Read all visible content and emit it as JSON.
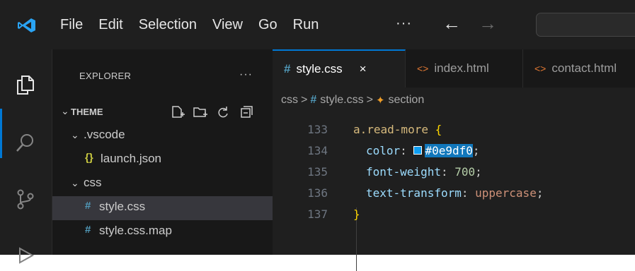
{
  "menu": {
    "items": [
      "File",
      "Edit",
      "Selection",
      "View",
      "Go",
      "Run"
    ],
    "more": "···",
    "back": "←",
    "forward": "→"
  },
  "sidebar": {
    "header": "EXPLORER",
    "more": "···",
    "root_folder": "THEME",
    "tree": [
      {
        "label": ".vscode",
        "type": "folder",
        "expanded": true
      },
      {
        "label": "launch.json",
        "type": "json",
        "icon": "{}"
      },
      {
        "label": "css",
        "type": "folder",
        "expanded": true
      },
      {
        "label": "style.css",
        "type": "css",
        "icon": "#",
        "selected": true
      },
      {
        "label": "style.css.map",
        "type": "css",
        "icon": "#"
      }
    ]
  },
  "tabs": [
    {
      "label": "style.css",
      "icon": "#",
      "active": true,
      "close": "×"
    },
    {
      "label": "index.html",
      "icon": "<>",
      "active": false
    },
    {
      "label": "contact.html",
      "icon": "<>",
      "active": false
    }
  ],
  "breadcrumb": {
    "folder": "css",
    "file": "style.css",
    "symbol": "section",
    "separator": ">"
  },
  "code": {
    "lines": [
      {
        "number": "133",
        "selector": "a.read-more",
        "brace_open": "{"
      },
      {
        "number": "134",
        "property": "color",
        "value": "#0e9df0",
        "swatch_color": "#0e9df0"
      },
      {
        "number": "135",
        "property": "font-weight",
        "value": "700"
      },
      {
        "number": "136",
        "property": "text-transform",
        "value": "uppercase"
      },
      {
        "number": "137",
        "brace_close": "}"
      }
    ]
  },
  "colors": {
    "accent": "#0078d4",
    "css_icon": "#519aba",
    "html_icon": "#e37933",
    "json_icon": "#cbcb41"
  }
}
